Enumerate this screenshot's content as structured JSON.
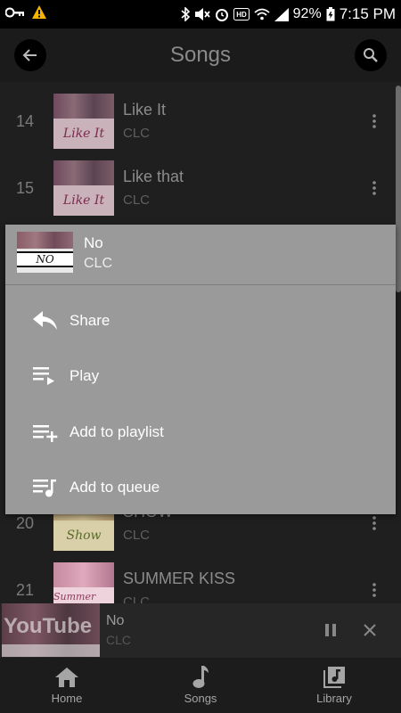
{
  "status_bar": {
    "battery": "92%",
    "time": "7:15 PM",
    "icons": [
      "key-icon",
      "warning-icon",
      "bluetooth-icon",
      "mute-icon",
      "alarm-icon",
      "hd-icon",
      "wifi-icon",
      "signal-icon",
      "battery-icon"
    ]
  },
  "header": {
    "title": "Songs",
    "back_icon": "arrow-left-icon",
    "search_icon": "search-icon"
  },
  "songs": [
    {
      "number": "14",
      "title": "Like It",
      "artist": "CLC",
      "thumb_caption": "Like It"
    },
    {
      "number": "15",
      "title": "Like that",
      "artist": "CLC",
      "thumb_caption": "Like It"
    },
    {
      "number": "20",
      "title": "SHOW",
      "artist": "CLC",
      "thumb_caption": "Show"
    },
    {
      "number": "21",
      "title": "SUMMER KISS",
      "artist": "CLC",
      "thumb_caption": "Summer Kiss"
    }
  ],
  "context_menu": {
    "song_title": "No",
    "song_artist": "CLC",
    "thumb_caption": "NO",
    "items": [
      {
        "label": "Share",
        "icon": "share-icon"
      },
      {
        "label": "Play",
        "icon": "play-queue-icon"
      },
      {
        "label": "Add to playlist",
        "icon": "playlist-add-icon"
      },
      {
        "label": "Add to queue",
        "icon": "queue-music-icon"
      }
    ]
  },
  "mini_player": {
    "title": "No",
    "artist": "CLC",
    "thumb_watermark": "YouTube"
  },
  "bottom_nav": [
    {
      "label": "Home",
      "icon": "home-icon"
    },
    {
      "label": "Songs",
      "icon": "music-note-icon"
    },
    {
      "label": "Library",
      "icon": "library-music-icon"
    }
  ],
  "colors": {
    "menu_bg": "#9a9a9a",
    "list_bg": "#1f1f1f",
    "header_bg": "#1b1b1b"
  }
}
